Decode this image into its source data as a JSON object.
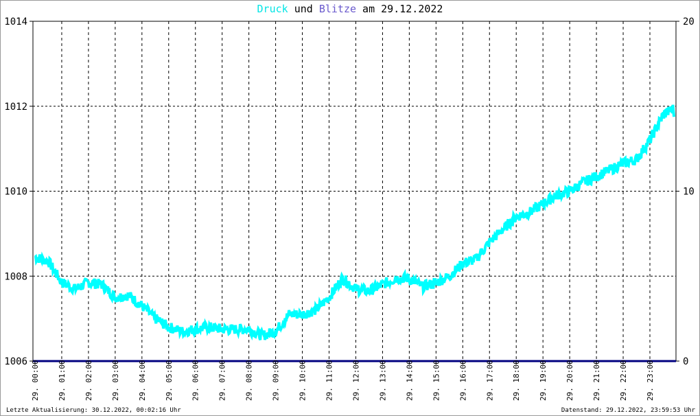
{
  "title": {
    "part1": "Druck",
    "part2": " und ",
    "part3": "Blitze",
    "part4": " am 29.12.2022"
  },
  "colors": {
    "druck": "#00ffff",
    "blitze": "#6a5acd",
    "axis": "#000080"
  },
  "footer": {
    "left": "Letzte Aktualisierung: 30.12.2022, 00:02:16 Uhr",
    "right": "Datenstand: 29.12.2022, 23:59:53 Uhr"
  },
  "chart_data": {
    "type": "line",
    "title": "Druck und Blitze am 29.12.2022",
    "x_unit": "hours",
    "xlim": [
      0,
      24
    ],
    "ylim_left": [
      1006,
      1014
    ],
    "yticks_left": [
      "1006",
      "1008",
      "1010",
      "1012",
      "1014"
    ],
    "ylim_right": [
      0,
      20
    ],
    "yticks_right": [
      "0",
      "10",
      "20"
    ],
    "xtick_labels": [
      "29. 00:00",
      "29. 01:00",
      "29. 02:00",
      "29. 03:00",
      "29. 04:00",
      "29. 05:00",
      "29. 06:00",
      "29. 07:00",
      "29. 08:00",
      "29. 09:00",
      "29. 10:00",
      "29. 11:00",
      "29. 12:00",
      "29. 13:00",
      "29. 14:00",
      "29. 15:00",
      "29. 16:00",
      "29. 17:00",
      "29. 18:00",
      "29. 19:00",
      "29. 20:00",
      "29. 21:00",
      "29. 22:00",
      "29. 23:00"
    ],
    "grid": true,
    "series": [
      {
        "name": "Druck",
        "x": [
          0,
          0.5,
          1,
          1.5,
          2,
          2.5,
          3,
          3.5,
          4,
          4.5,
          5,
          5.5,
          6,
          6.5,
          7,
          7.5,
          8,
          8.5,
          9,
          9.5,
          10,
          10.5,
          11,
          11.5,
          12,
          12.5,
          13,
          13.5,
          14,
          14.5,
          15,
          15.5,
          16,
          16.5,
          17,
          17.5,
          18,
          18.5,
          19,
          19.5,
          20,
          20.5,
          21,
          21.5,
          22,
          22.5,
          23,
          23.5,
          23.9
        ],
        "values": [
          1008.45,
          1008.35,
          1007.85,
          1007.7,
          1007.85,
          1007.8,
          1007.5,
          1007.55,
          1007.3,
          1007.0,
          1006.8,
          1006.7,
          1006.75,
          1006.8,
          1006.75,
          1006.75,
          1006.75,
          1006.6,
          1006.7,
          1007.1,
          1007.1,
          1007.2,
          1007.5,
          1007.95,
          1007.7,
          1007.65,
          1007.8,
          1007.95,
          1007.95,
          1007.75,
          1007.85,
          1008.0,
          1008.3,
          1008.4,
          1008.8,
          1009.1,
          1009.4,
          1009.5,
          1009.7,
          1009.9,
          1010.0,
          1010.2,
          1010.35,
          1010.5,
          1010.65,
          1010.75,
          1011.2,
          1011.8,
          1011.95
        ]
      },
      {
        "name": "Blitze",
        "x": [],
        "values": []
      }
    ]
  }
}
